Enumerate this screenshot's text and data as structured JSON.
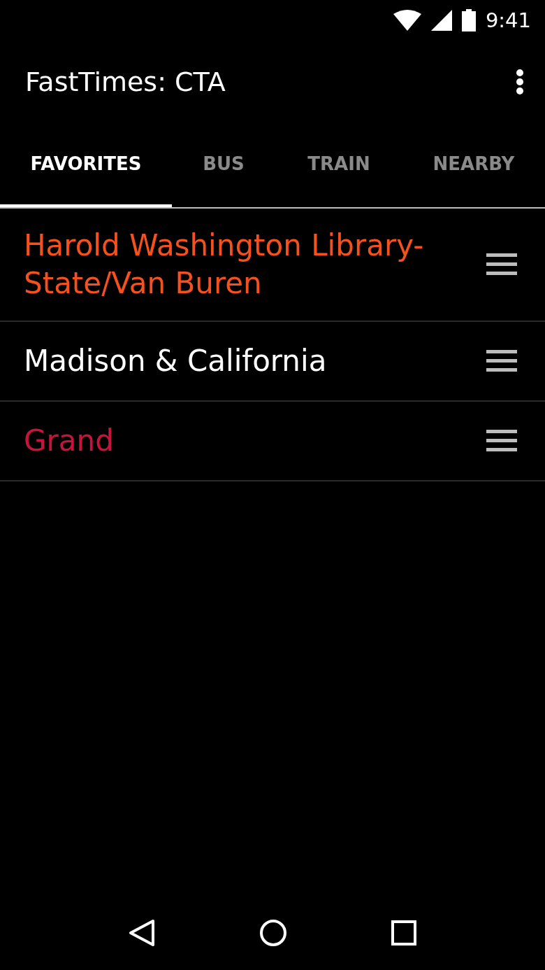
{
  "status_bar": {
    "time": "9:41"
  },
  "app_bar": {
    "title": "FastTimes: CTA"
  },
  "tabs": [
    {
      "label": "FAVORITES",
      "selected": true
    },
    {
      "label": "BUS",
      "selected": false
    },
    {
      "label": "TRAIN",
      "selected": false
    },
    {
      "label": "NEARBY",
      "selected": false
    }
  ],
  "favorites": [
    {
      "name": "Harold Washington Library-State/Van Buren",
      "color": "#f4511e"
    },
    {
      "name": "Madison & California",
      "color": "#ffffff"
    },
    {
      "name": "Grand",
      "color": "#c8133d"
    }
  ]
}
